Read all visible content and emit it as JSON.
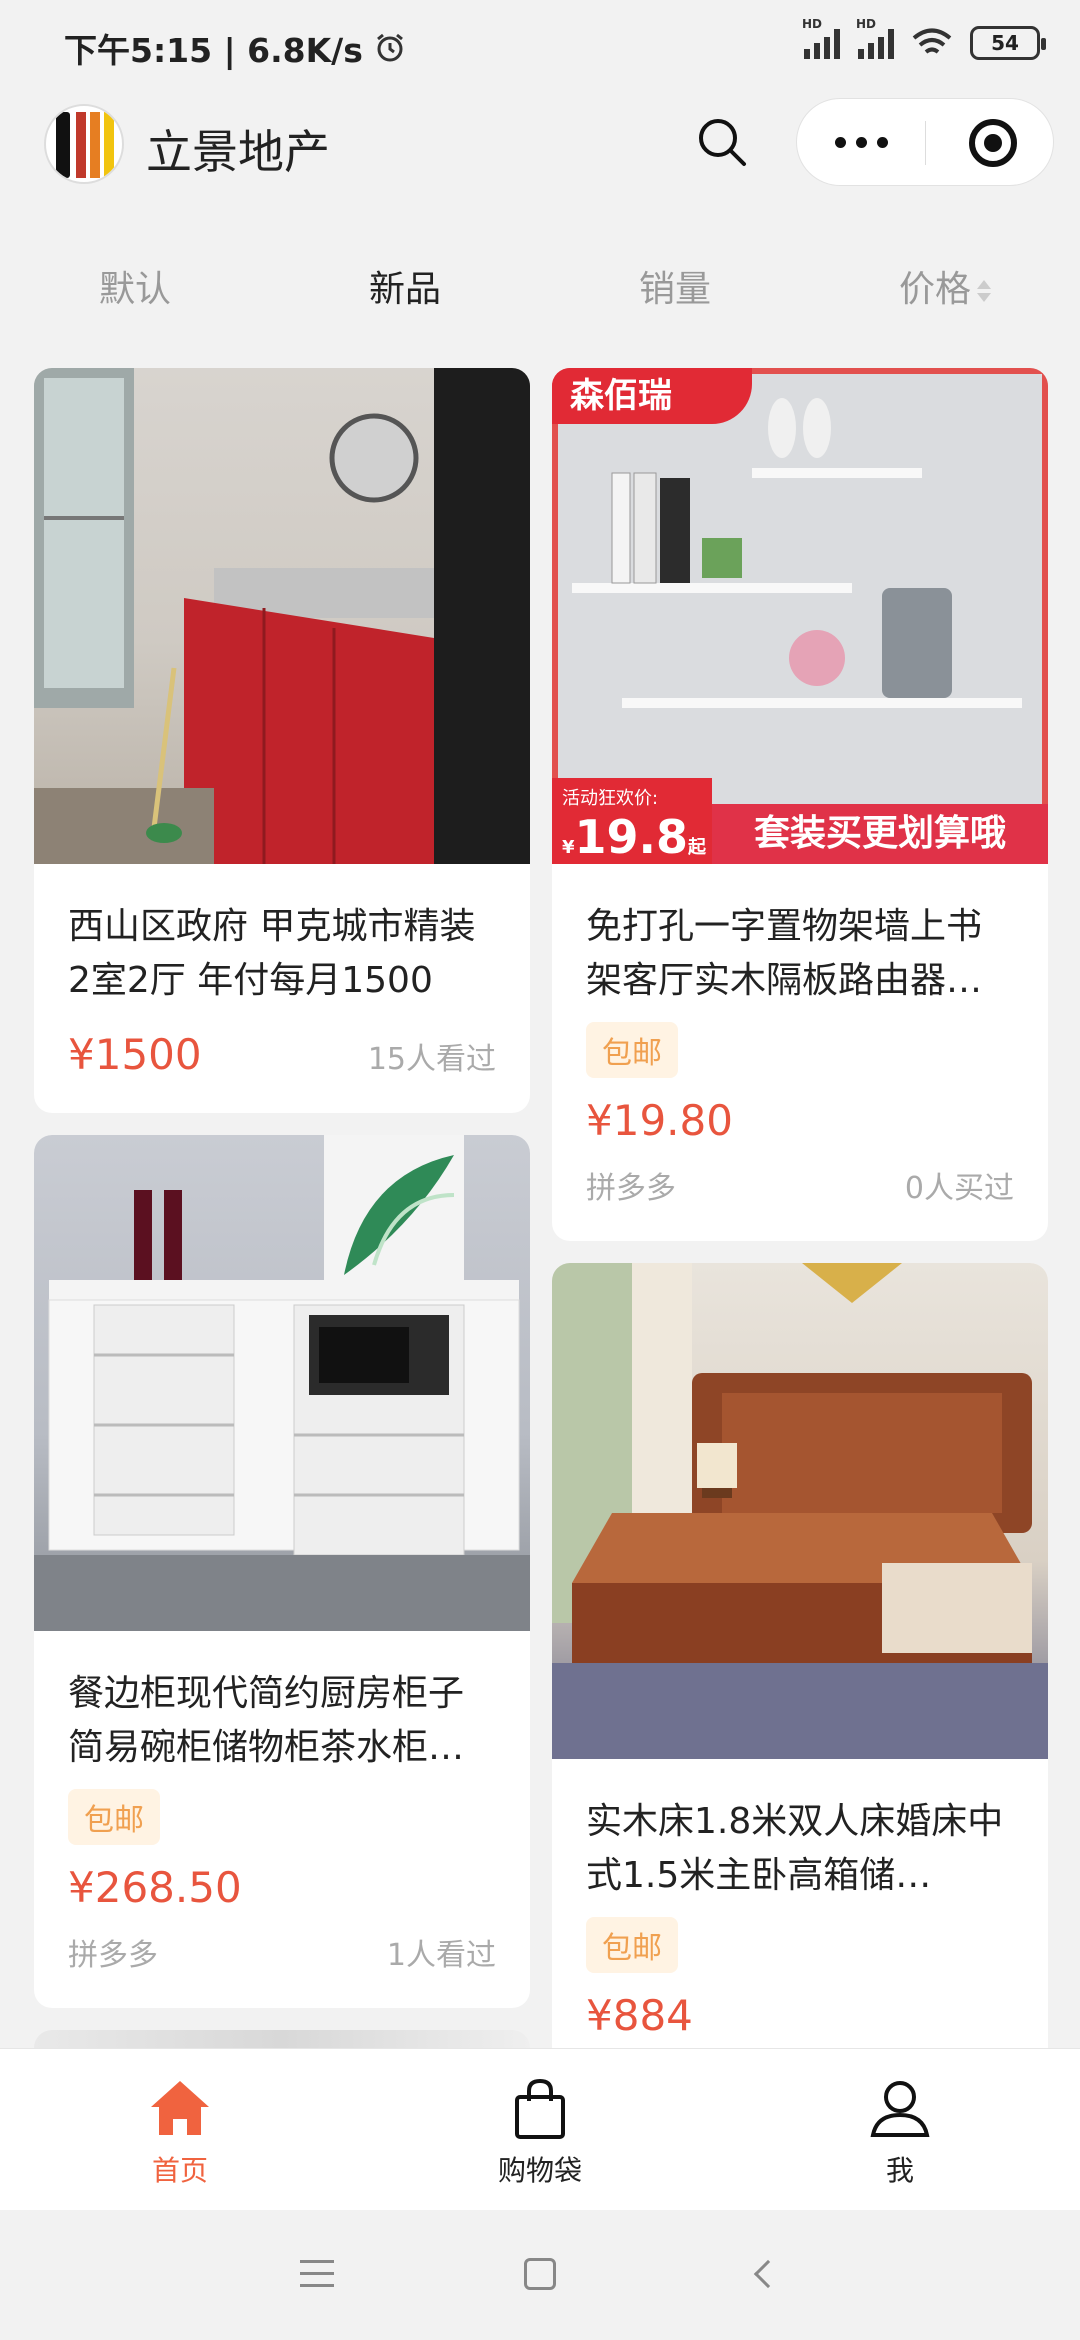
{
  "status": {
    "time_speed": "下午5:15 | 6.8K/s",
    "battery": "54"
  },
  "header": {
    "title": "立景地产"
  },
  "sort_tabs": [
    {
      "label": "默认"
    },
    {
      "label": "新品"
    },
    {
      "label": "销量"
    },
    {
      "label": "价格"
    }
  ],
  "products": [
    {
      "title": "西山区政府 甲克城市精装2室2厅 年付每月1500",
      "price": "¥1500",
      "meta_right": "15人看过"
    },
    {
      "title": "免打孔一字置物架墙上书架客厅实木隔板路由器…",
      "tag": "包邮",
      "price": "¥19.80",
      "meta_left": "拼多多",
      "meta_right": "0人买过",
      "banner_brand": "森佰瑞",
      "banner_promo": "活动狂欢价:",
      "banner_price": "19.8",
      "banner_price_unit": "起",
      "banner_slogan": "套装买更划算哦"
    },
    {
      "title": "餐边柜现代简约厨房柜子简易碗柜储物柜茶水柜…",
      "tag": "包邮",
      "price": "¥268.50",
      "meta_left": "拼多多",
      "meta_right": "1人看过"
    },
    {
      "title": "实木床1.8米双人床婚床中式1.5米主卧高箱储…",
      "tag": "包邮",
      "price": "¥884"
    }
  ],
  "tabbar": [
    {
      "label": "首页"
    },
    {
      "label": "购物袋"
    },
    {
      "label": "我"
    }
  ],
  "colors": {
    "accent": "#f0633f",
    "price": "#e8553e",
    "tag_bg": "#fff3e3",
    "tag_text": "#f0a050"
  }
}
